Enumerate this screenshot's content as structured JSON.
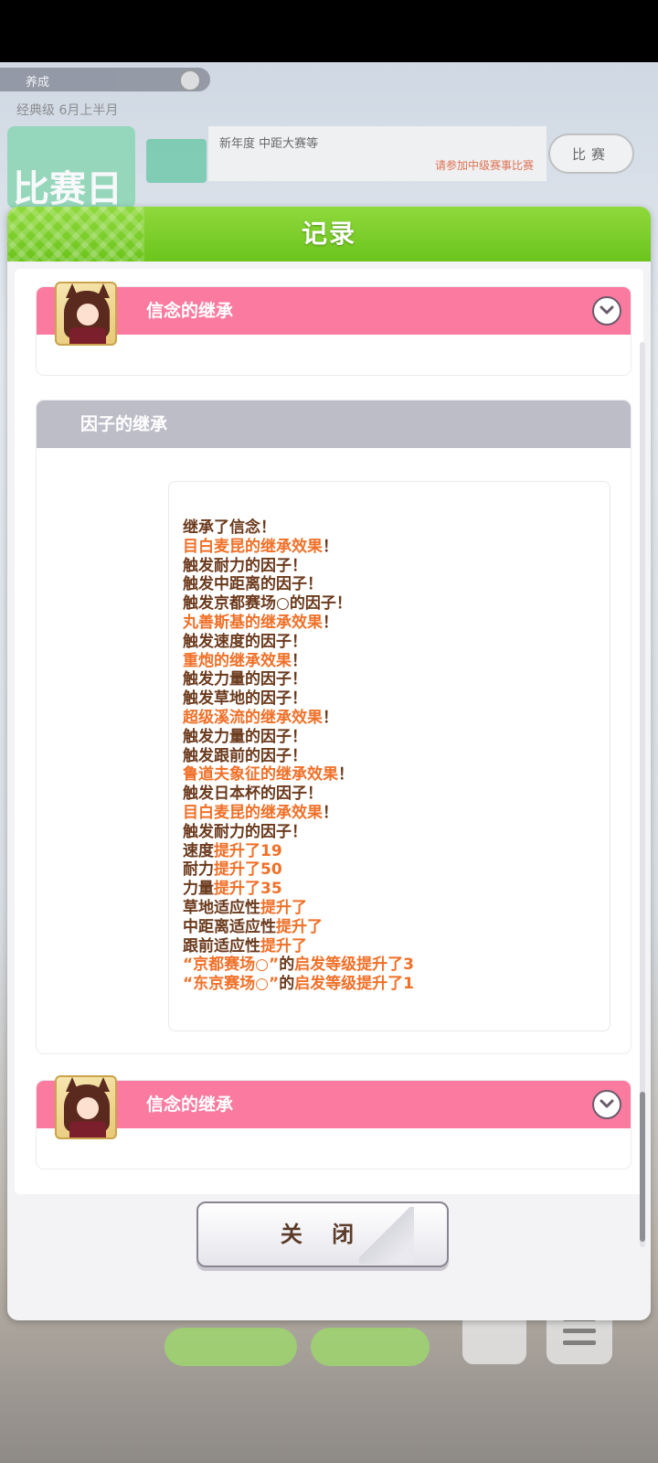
{
  "background": {
    "top_bar_label": "养成",
    "date_text": "经典级 6月上半月",
    "race_day_text": "比赛日",
    "info_text": "新年度 中距大赛等",
    "info_subtext": "请参加中级赛事比赛",
    "side_button_label": "比赛"
  },
  "dialog": {
    "title": "记录",
    "close_label": "关 闭"
  },
  "cards": [
    {
      "title": "信念的继承"
    },
    {
      "title": "因子的继承"
    },
    {
      "title": "信念的继承"
    }
  ],
  "log": [
    [
      {
        "t": "继承了信念！",
        "h": false
      }
    ],
    [
      {
        "t": "目白麦昆的继承效果",
        "h": true
      },
      {
        "t": "！",
        "h": false
      }
    ],
    [
      {
        "t": "触发耐力的因子！",
        "h": false
      }
    ],
    [
      {
        "t": "触发中距离的因子！",
        "h": false
      }
    ],
    [
      {
        "t": "触发京都赛场○的因子！",
        "h": false
      }
    ],
    [
      {
        "t": "丸善斯基的继承效果",
        "h": true
      },
      {
        "t": "！",
        "h": false
      }
    ],
    [
      {
        "t": "触发速度的因子！",
        "h": false
      }
    ],
    [
      {
        "t": "重炮的继承效果",
        "h": true
      },
      {
        "t": "！",
        "h": false
      }
    ],
    [
      {
        "t": "触发力量的因子！",
        "h": false
      }
    ],
    [
      {
        "t": "触发草地的因子！",
        "h": false
      }
    ],
    [
      {
        "t": "超级溪流的继承效果",
        "h": true
      },
      {
        "t": "！",
        "h": false
      }
    ],
    [
      {
        "t": "触发力量的因子！",
        "h": false
      }
    ],
    [
      {
        "t": "触发跟前的因子！",
        "h": false
      }
    ],
    [
      {
        "t": "鲁道夫象征的继承效果",
        "h": true
      },
      {
        "t": "！",
        "h": false
      }
    ],
    [
      {
        "t": "触发日本杯的因子！",
        "h": false
      }
    ],
    [
      {
        "t": "目白麦昆的继承效果",
        "h": true
      },
      {
        "t": "！",
        "h": false
      }
    ],
    [
      {
        "t": "触发耐力的因子！",
        "h": false
      }
    ],
    [
      {
        "t": "速度",
        "h": false
      },
      {
        "t": "提升了19",
        "h": true
      }
    ],
    [
      {
        "t": "耐力",
        "h": false
      },
      {
        "t": "提升了50",
        "h": true
      }
    ],
    [
      {
        "t": "力量",
        "h": false
      },
      {
        "t": "提升了35",
        "h": true
      }
    ],
    [
      {
        "t": "草地适应性",
        "h": false
      },
      {
        "t": "提升了",
        "h": true
      }
    ],
    [
      {
        "t": "中距离适应性",
        "h": false
      },
      {
        "t": "提升了",
        "h": true
      }
    ],
    [
      {
        "t": "跟前适应性",
        "h": false
      },
      {
        "t": "提升了",
        "h": true
      }
    ],
    [
      {
        "t": "“京都赛场○”",
        "h": true
      },
      {
        "t": "的",
        "h": false
      },
      {
        "t": "启发等级提升了3",
        "h": true
      }
    ],
    [
      {
        "t": "“东京赛场○”",
        "h": true
      },
      {
        "t": "的",
        "h": false
      },
      {
        "t": "启发等级提升了1",
        "h": true
      }
    ]
  ],
  "colors": {
    "header_green": "#7ccf2c",
    "pink_bar": "#fb7aa0",
    "gray_bar": "#bdbdc8",
    "text_brown": "#6b3a1d",
    "highlight_orange": "#f07028"
  },
  "icons": [
    "chevron-down-icon",
    "character-avatar",
    "menu-icon"
  ]
}
